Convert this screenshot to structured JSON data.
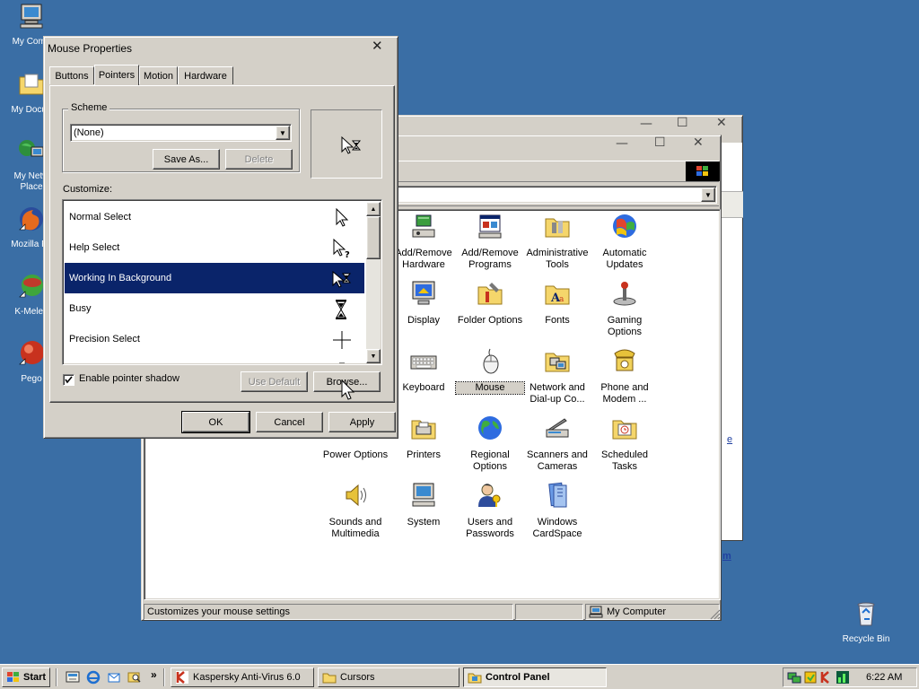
{
  "desktop": {
    "icons": [
      {
        "label": "My Comp"
      },
      {
        "label": "My Docun"
      },
      {
        "label": "My Netw"
      },
      {
        "label": "Place"
      },
      {
        "label": "Mozilla Fir"
      },
      {
        "label": "K-Meleo"
      },
      {
        "label": "Pego"
      }
    ],
    "recycle_bin": "Recycle Bin"
  },
  "control_panel": {
    "items": [
      {
        "label": "Add/Remove Hardware"
      },
      {
        "label": "Add/Remove Programs"
      },
      {
        "label": "Administrative Tools"
      },
      {
        "label": "Automatic Updates"
      },
      {
        "label": "Display"
      },
      {
        "label": "Folder Options"
      },
      {
        "label": "Fonts"
      },
      {
        "label": "Gaming Options"
      },
      {
        "label": "Keyboard"
      },
      {
        "label": "Mouse"
      },
      {
        "label": "Network and Dial-up Co..."
      },
      {
        "label": "Phone and Modem ..."
      },
      {
        "label": "Power Options"
      },
      {
        "label": "Printers"
      },
      {
        "label": "Regional Options"
      },
      {
        "label": "Scanners and Cameras"
      },
      {
        "label": "Scheduled Tasks"
      },
      {
        "label": "Sounds and Multimedia"
      },
      {
        "label": "System"
      },
      {
        "label": "Users and Passwords"
      },
      {
        "label": "Windows CardSpace"
      }
    ],
    "status": "Customizes your mouse settings",
    "zone": "My Computer",
    "side_link_1": "e",
    "side_link_2": "m"
  },
  "dialog": {
    "title": "Mouse Properties",
    "tabs": [
      {
        "label": "Buttons"
      },
      {
        "label": "Pointers"
      },
      {
        "label": "Motion"
      },
      {
        "label": "Hardware"
      }
    ],
    "scheme_label": "Scheme",
    "scheme_value": "(None)",
    "save_as": "Save As...",
    "delete": "Delete",
    "customize_label": "Customize:",
    "pointers": [
      {
        "label": "Normal Select"
      },
      {
        "label": "Help Select"
      },
      {
        "label": "Working In Background"
      },
      {
        "label": "Busy"
      },
      {
        "label": "Precision Select"
      }
    ],
    "enable_shadow": "Enable pointer shadow",
    "use_default": "Use Default",
    "browse": "Browse...",
    "ok": "OK",
    "cancel": "Cancel",
    "apply": "Apply"
  },
  "taskbar": {
    "start": "Start",
    "tasks": [
      {
        "label": "Kaspersky Anti-Virus 6.0"
      },
      {
        "label": "Cursors"
      },
      {
        "label": "Control Panel"
      }
    ],
    "clock": "6:22 AM",
    "chevron": "»"
  }
}
